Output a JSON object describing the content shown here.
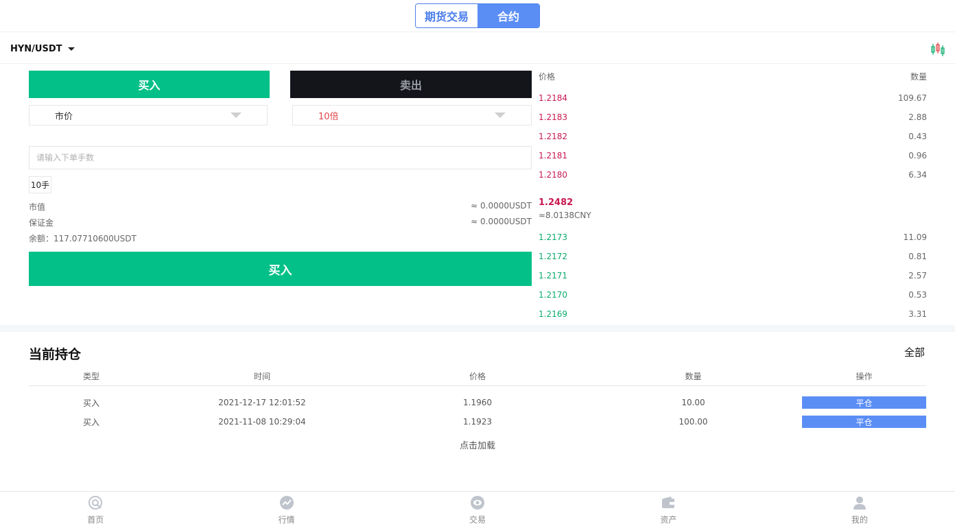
{
  "header": {
    "tabs": [
      {
        "label": "期货交易",
        "active": false
      },
      {
        "label": "合约",
        "active": true
      }
    ],
    "pair": "HYN/USDT",
    "kline_icon": "candlestick-chart-icon"
  },
  "trade": {
    "buy_tab": "买入",
    "sell_tab": "卖出",
    "order_type": "市价",
    "leverage": "10倍",
    "qty_placeholder": "请输入下单手数",
    "lot_option": "10手",
    "market_value_label": "市值",
    "market_value": "≈ 0.0000USDT",
    "margin_label": "保证金",
    "margin_value": "≈ 0.0000USDT",
    "balance": "余额：117.07710600USDT",
    "submit": "买入",
    "colors": {
      "buy": "#02c087",
      "sell": "#13151b",
      "ask": "#c8184f",
      "bid": "#0aaa6a"
    }
  },
  "orderbook": {
    "price_header": "价格",
    "qty_header": "数量",
    "asks": [
      {
        "price": "1.2184",
        "qty": "109.67"
      },
      {
        "price": "1.2183",
        "qty": "2.88"
      },
      {
        "price": "1.2182",
        "qty": "0.43"
      },
      {
        "price": "1.2181",
        "qty": "0.96"
      },
      {
        "price": "1.2180",
        "qty": "6.34"
      }
    ],
    "last_price": "1.2482",
    "last_cny": "≈8.0138CNY",
    "bids": [
      {
        "price": "1.2173",
        "qty": "11.09"
      },
      {
        "price": "1.2172",
        "qty": "0.81"
      },
      {
        "price": "1.2171",
        "qty": "2.57"
      },
      {
        "price": "1.2170",
        "qty": "0.53"
      },
      {
        "price": "1.2169",
        "qty": "3.31"
      }
    ]
  },
  "positions": {
    "title": "当前持仓",
    "all": "全部",
    "columns": [
      "类型",
      "时间",
      "价格",
      "数量",
      "操作"
    ],
    "rows": [
      {
        "type": "买入",
        "time": "2021-12-17 12:01:52",
        "price": "1.1960",
        "qty": "10.00",
        "action": "平仓"
      },
      {
        "type": "买入",
        "time": "2021-11-08 10:29:04",
        "price": "1.1923",
        "qty": "100.00",
        "action": "平仓"
      }
    ],
    "load_more": "点击加载"
  },
  "nav": [
    {
      "label": "首页",
      "icon": "home-icon"
    },
    {
      "label": "行情",
      "icon": "market-icon"
    },
    {
      "label": "交易",
      "icon": "trade-icon"
    },
    {
      "label": "资产",
      "icon": "wallet-icon"
    },
    {
      "label": "我的",
      "icon": "user-icon"
    }
  ]
}
